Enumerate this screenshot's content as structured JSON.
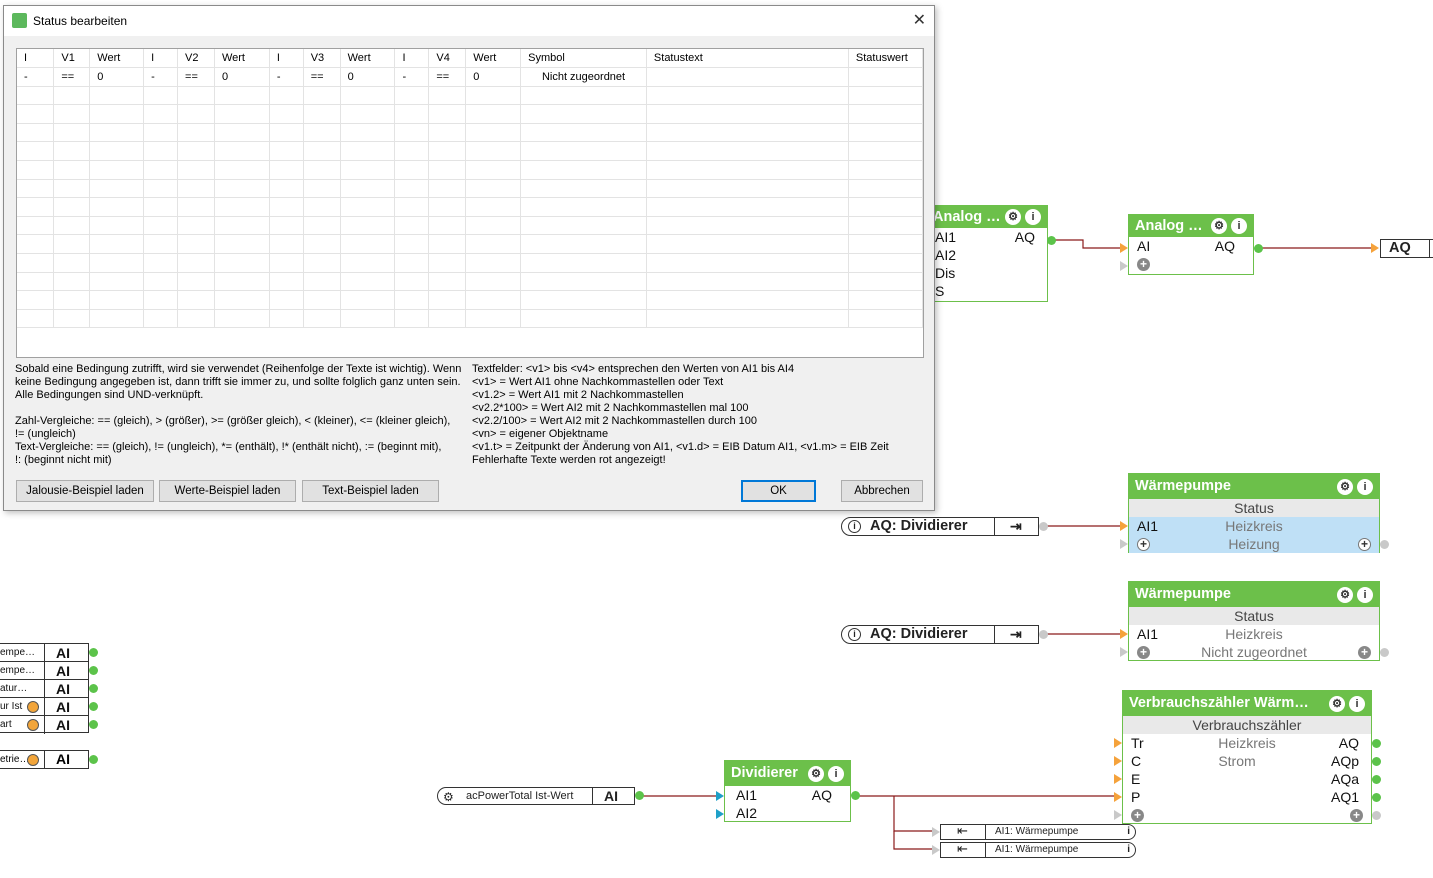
{
  "dialog": {
    "title": "Status bearbeiten",
    "close_glyph": "✕",
    "columns": [
      "I",
      "V1",
      "Wert",
      "I",
      "V2",
      "Wert",
      "I",
      "V3",
      "Wert",
      "I",
      "V4",
      "Wert",
      "Symbol",
      "Statustext",
      "Statuswert"
    ],
    "rows": [
      [
        "-",
        "==",
        "0",
        "-",
        "==",
        "0",
        "-",
        "==",
        "0",
        "-",
        "==",
        "0",
        "Nicht zugeordnet",
        "",
        ""
      ]
    ],
    "help_left": "Sobald eine Bedingung zutrifft, wird sie verwendet (Reihenfolge der Texte ist wichtig). Wenn\nkeine Bedingung angegeben ist, dann trifft sie immer zu, und sollte folglich ganz unten sein.\nAlle Bedingungen sind UND-verknüpft.\n\nZahl-Vergleiche: == (gleich), > (größer), >= (größer gleich), < (kleiner), <= (kleiner gleich),\n!= (ungleich)\nText-Vergleiche: == (gleich), != (ungleich), *= (enthält), !* (enthält nicht), := (beginnt mit),\n!: (beginnt nicht mit)",
    "help_right": "Textfelder: <v1> bis <v4> entsprechen den Werten von AI1 bis AI4\n<v1> = Wert AI1 ohne Nachkommastellen oder Text\n<v1.2> = Wert AI1 mit 2 Nachkommastellen\n<v2.2*100> = Wert AI2 mit 2 Nachkommastellen mal 100\n<v2.2/100> = Wert AI2 mit 2 Nachkommastellen durch 100\n<vn> = eigener Objektname\n<v1.t> = Zeitpunkt der Änderung von AI1, <v1.d> = EIB Datum AI1, <v1.m> = EIB Zeit\nFehlerhafte Texte werden rot angezeigt!",
    "buttons": {
      "jalousie": "Jalousie-Beispiel laden",
      "werte": "Werte-Beispiel laden",
      "text": "Text-Beispiel laden",
      "ok": "OK",
      "cancel": "Abbrechen"
    }
  },
  "canvas": {
    "analog1": {
      "title": "Analog …",
      "inputs": [
        "AI1",
        "AI2",
        "Dis",
        "S"
      ],
      "output": "AQ"
    },
    "analog2": {
      "title": "Analog …",
      "input": "AI",
      "output": "AQ"
    },
    "aq_ref": "AQ",
    "waerme1": {
      "title": "Wärmepumpe",
      "subtitle": "Status",
      "input": "AI1",
      "text1": "Heizkreis",
      "text2": "Heizung"
    },
    "waerme2": {
      "title": "Wärmepumpe",
      "subtitle": "Status",
      "input": "AI1",
      "text1": "Heizkreis",
      "text2": "Nicht zugeordnet"
    },
    "div_ref1": "AQ: Dividierer",
    "div_ref2": "AQ: Dividierer",
    "verbrauch": {
      "title": "Verbrauchszähler  Wärm…",
      "subtitle": "Verbrauchszähler",
      "inputs": [
        "Tr",
        "C",
        "E",
        "P"
      ],
      "outputs": [
        "AQ",
        "AQp",
        "AQa",
        "AQ1"
      ],
      "text1": "Heizkreis",
      "text2": "Strom"
    },
    "dividierer": {
      "title": "Dividierer",
      "inputs": [
        "AI1",
        "AI2"
      ],
      "output": "AQ"
    },
    "power_ref": {
      "label": "acPowerTotal Ist-Wert",
      "type": "AI"
    },
    "ai_refs": [
      {
        "label": "empe…",
        "type": "AI"
      },
      {
        "label": "empe…",
        "type": "AI"
      },
      {
        "label": "atur…",
        "type": "AI"
      },
      {
        "label": "ur  Ist",
        "type": "AI"
      },
      {
        "label": "art",
        "type": "AI"
      }
    ],
    "ai_ref_extra": {
      "label": "etrie…",
      "type": "AI"
    },
    "small_refs": [
      "AI1: Wärmepumpe",
      "AI1: Wärmepumpe"
    ]
  }
}
